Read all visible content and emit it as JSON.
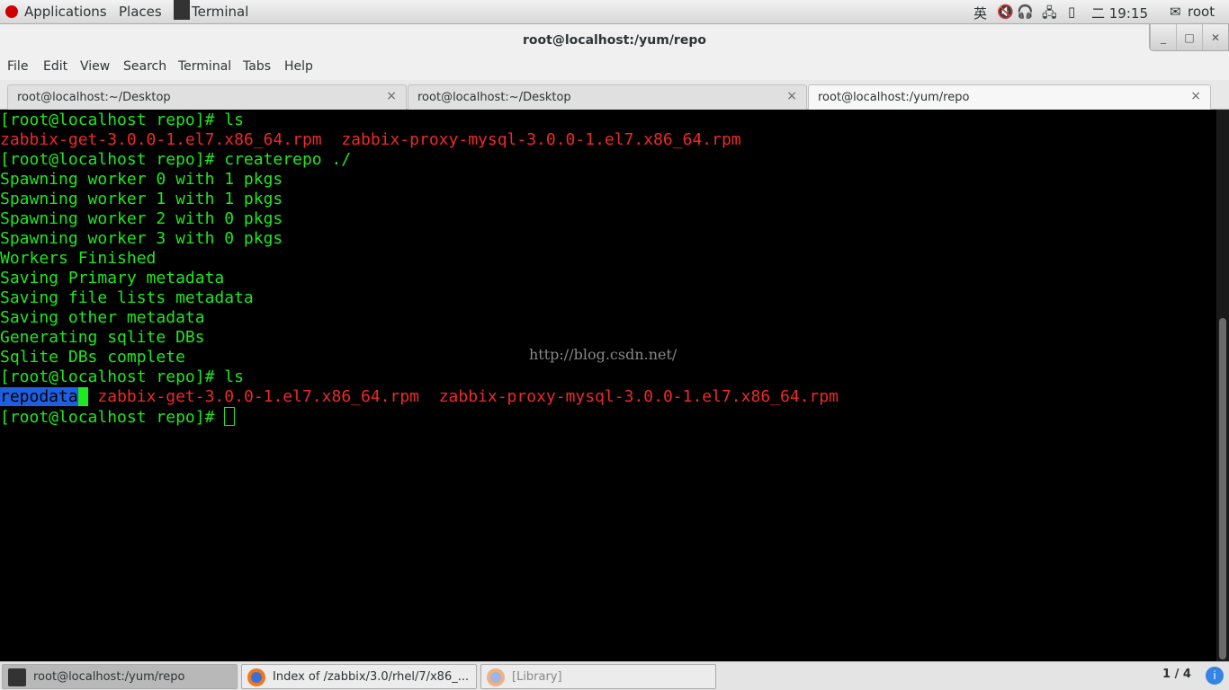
{
  "topbar": {
    "applications": "Applications",
    "places": "Places",
    "terminal": "Terminal",
    "input_method": "英",
    "clock": "二 19:15",
    "user": "root"
  },
  "window": {
    "title": "root@localhost:/yum/repo",
    "minimize": "_",
    "maximize": "□",
    "close": "✕"
  },
  "menu": [
    "File",
    "Edit",
    "View",
    "Search",
    "Terminal",
    "Tabs",
    "Help"
  ],
  "tabs": [
    {
      "label": "root@localhost:~/Desktop"
    },
    {
      "label": "root@localhost:~/Desktop"
    },
    {
      "label": "root@localhost:/yum/repo"
    }
  ],
  "tab_close": "×",
  "terminal": {
    "prompt": "[root@localhost repo]# ",
    "cmd1": "ls",
    "file1": "zabbix-get-3.0.0-1.el7.x86_64.rpm",
    "file2": "zabbix-proxy-mysql-3.0.0-1.el7.x86_64.rpm",
    "cmd2": "createrepo ./",
    "output": [
      "Spawning worker 0 with 1 pkgs",
      "Spawning worker 1 with 1 pkgs",
      "Spawning worker 2 with 0 pkgs",
      "Spawning worker 3 with 0 pkgs",
      "Workers Finished",
      "Saving Primary metadata",
      "Saving file lists metadata",
      "Saving other metadata",
      "Generating sqlite DBs",
      "Sqlite DBs complete"
    ],
    "cmd3": "ls",
    "dir1": "repodata"
  },
  "watermark": "http://blog.csdn.net/",
  "taskbar": {
    "items": [
      {
        "label": "root@localhost:/yum/repo"
      },
      {
        "label": "Index of /zabbix/3.0/rhel/7/x86_..."
      },
      {
        "label": "[Library]"
      }
    ],
    "workspace": "1 / 4"
  },
  "colors": {
    "prompt_green": "#1ee91e",
    "file_red": "#ef2929",
    "dir_highlight": "#1e5fe0"
  }
}
